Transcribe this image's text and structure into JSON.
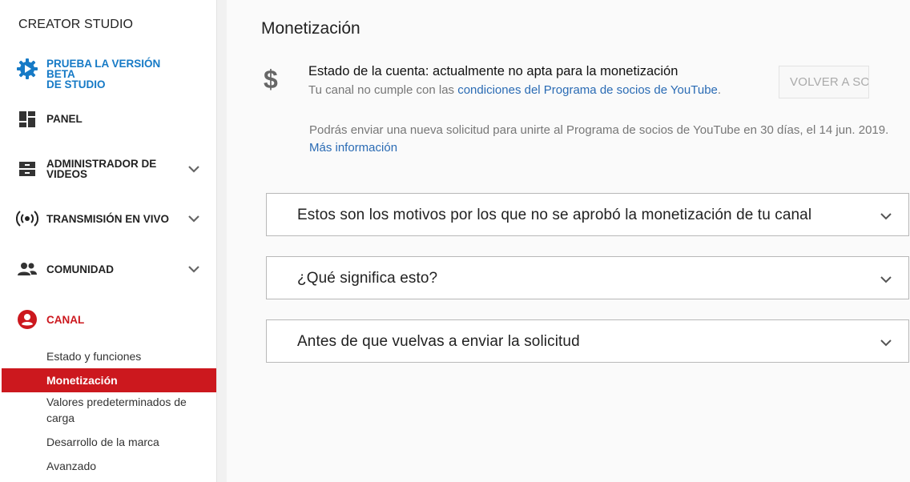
{
  "sidebar": {
    "brand": "CREATOR STUDIO",
    "items": [
      {
        "label_line1": "PRUEBA LA VERSIÓN BETA",
        "label_line2": "DE STUDIO",
        "icon": "gear-play-icon"
      },
      {
        "label": "PANEL",
        "icon": "dashboard-icon"
      },
      {
        "label_line1": "ADMINISTRADOR DE",
        "label_line2": "VIDEOS",
        "icon": "video-manager-icon"
      },
      {
        "label": "TRANSMISIÓN EN VIVO",
        "icon": "live-broadcast-icon"
      },
      {
        "label": "COMUNIDAD",
        "icon": "community-icon"
      },
      {
        "label": "CANAL",
        "icon": "channel-icon"
      }
    ],
    "sub_items": [
      {
        "label": "Estado y funciones"
      },
      {
        "label": "Monetización"
      },
      {
        "label_line1": "Valores predeterminados de",
        "label_line2": "carga"
      },
      {
        "label": "Desarrollo de la marca"
      },
      {
        "label": "Avanzado"
      }
    ]
  },
  "main": {
    "title": "Monetización",
    "status": {
      "title": "Estado de la cuenta: actualmente no apta para la monetización",
      "desc_prefix": "Tu canal no cumple con las ",
      "desc_link": "condiciones del Programa de socios de YouTube",
      "desc_suffix": "."
    },
    "reapply_button": "VOLVER A SOLICITAR",
    "reapply_text": "Podrás enviar una nueva solicitud para unirte al Programa de socios de YouTube en 30 días, el 14 jun. 2019. ",
    "reapply_link": "Más información",
    "accordions": [
      {
        "title": "Estos son los motivos por los que no se aprobó la monetización de tu canal"
      },
      {
        "title": "¿Qué significa esto?"
      },
      {
        "title": "Antes de que vuelvas a enviar la solicitud"
      }
    ]
  },
  "colors": {
    "accent_red": "#cc181e",
    "accent_blue": "#167ac6",
    "link_blue": "#2a6bb4"
  }
}
